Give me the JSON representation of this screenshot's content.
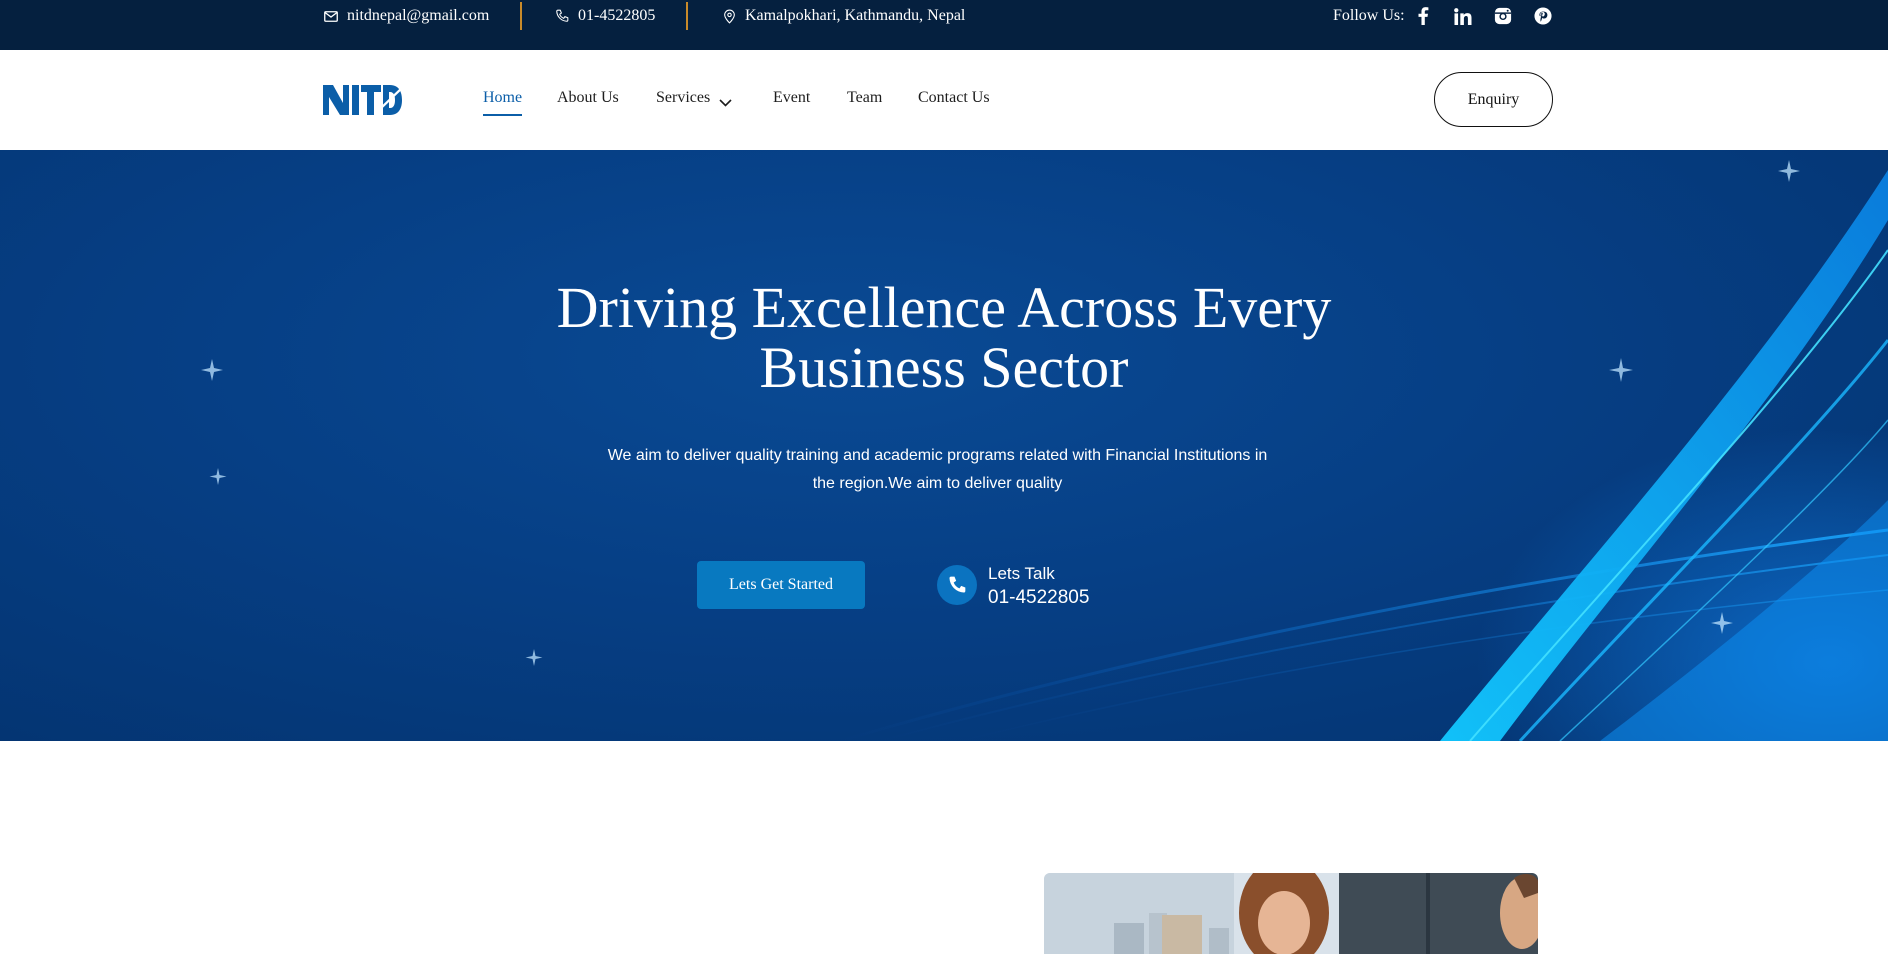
{
  "topbar": {
    "email": "nitdnepal@gmail.com",
    "phone": "01-4522805",
    "address": "Kamalpokhari, Kathmandu, Nepal",
    "follow_label": "Follow Us:",
    "social_icons": [
      "facebook-icon",
      "linkedin-icon",
      "instagram-icon",
      "pinterest-icon"
    ]
  },
  "nav": {
    "logo_text": "NITD",
    "items": [
      {
        "label": "Home",
        "active": true
      },
      {
        "label": "About Us"
      },
      {
        "label": "Services",
        "has_dropdown": true
      },
      {
        "label": "Event"
      },
      {
        "label": "Team"
      },
      {
        "label": "Contact Us"
      }
    ],
    "enquiry_label": "Enquiry"
  },
  "hero": {
    "title_line1": "Driving Excellence Across Every",
    "title_line2": "Business Sector",
    "subtitle_line1": "We aim to deliver quality training and academic programs related with Financial Institutions in",
    "subtitle_line2": "the region.We aim to deliver quality",
    "cta_label": "Lets Get Started",
    "talk_label": "Lets Talk",
    "talk_phone": "01-4522805"
  },
  "colors": {
    "topbar_bg": "#05203f",
    "accent_blue": "#0b5ea8",
    "hero_bg": "#063f85",
    "cta_bg": "#0879c0",
    "separator": "#c98a2a"
  }
}
